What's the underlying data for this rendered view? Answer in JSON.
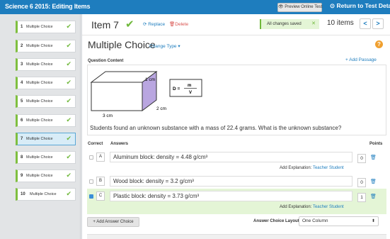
{
  "header": {
    "app_title": "Science 6 2015: Editing Items",
    "preview_label": "Preview Online Test",
    "return_label": "Return to Test Details"
  },
  "sidebar": {
    "items": [
      {
        "num": "1",
        "label": "Multiple Choice"
      },
      {
        "num": "2",
        "label": "Multiple Choice"
      },
      {
        "num": "3",
        "label": "Multiple Choice"
      },
      {
        "num": "4",
        "label": "Multiple Choice"
      },
      {
        "num": "5",
        "label": "Multiple Choice"
      },
      {
        "num": "6",
        "label": "Multiple Choice"
      },
      {
        "num": "7",
        "label": "Multiple Choice"
      },
      {
        "num": "8",
        "label": "Multiple Choice"
      },
      {
        "num": "9",
        "label": "Multiple Choice"
      },
      {
        "num": "10",
        "label": "Multiple Choice"
      }
    ],
    "active_index": 6
  },
  "item_bar": {
    "title": "Item 7",
    "replace_label": "Replace",
    "delete_label": "Delete",
    "save_status": "All changes saved",
    "item_count": "10 items",
    "prev_label": "<",
    "next_label": ">"
  },
  "editor": {
    "type_title": "Multiple Choice",
    "change_type_label": "Change Type ▾",
    "question_content_label": "Question Content",
    "add_passage_label": "+ Add Passage",
    "figure": {
      "height_label": "1 cm",
      "depth_label": "2 cm",
      "width_label": "3 cm",
      "formula_lhs": "D =",
      "formula_num": "m",
      "formula_den": "V"
    },
    "question_text": "Students found an unknown substance with a mass of 22.4 grams. What is the unknown substance?",
    "correct_header": "Correct",
    "answers_header": "Answers",
    "points_header": "Points",
    "answers": [
      {
        "letter": "A",
        "text": "Aluminum block: density = 4.48 g/cm³",
        "points": "0",
        "correct": false
      },
      {
        "letter": "B",
        "text": "Wood block: density = 3.2 g/cm³",
        "points": "0",
        "correct": false
      },
      {
        "letter": "C",
        "text": "Plastic block: density = 3.73 g/cm³",
        "points": "1",
        "correct": true
      }
    ],
    "add_explanation_label": "Add Explanation:",
    "teacher_label": "Teacher",
    "student_label": "Student",
    "add_answer_label": "+ Add Answer Choice",
    "layout_label": "Answer Choice Layout",
    "layout_value": "One Column"
  },
  "colors": {
    "brand_blue": "#1e7dbe",
    "success_green": "#6fb83a",
    "delete_red": "#d9534f",
    "help_orange": "#f0a030"
  }
}
